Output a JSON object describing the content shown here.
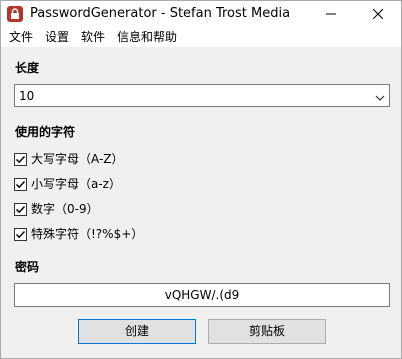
{
  "window": {
    "title": "PasswordGenerator - Stefan Trost Media",
    "icons": {
      "app": "lock-icon",
      "minimize": "minimize-icon",
      "close": "close-icon"
    }
  },
  "menu": {
    "items": [
      "文件",
      "设置",
      "软件",
      "信息和帮助"
    ]
  },
  "length": {
    "label": "长度",
    "value": "10"
  },
  "chars": {
    "label": "使用的字符",
    "options": [
      {
        "label": "大写字母（A-Z）",
        "checked": true
      },
      {
        "label": "小写字母（a-z）",
        "checked": true
      },
      {
        "label": "数字（0-9）",
        "checked": true
      },
      {
        "label": "特殊字符（!?%$+）",
        "checked": true
      }
    ]
  },
  "password": {
    "label": "密码",
    "value": "vQHGW/.(d9"
  },
  "buttons": {
    "create": "创建",
    "clipboard": "剪贴板"
  },
  "colors": {
    "accent": "#0078d7",
    "icon": "#b3372d"
  }
}
